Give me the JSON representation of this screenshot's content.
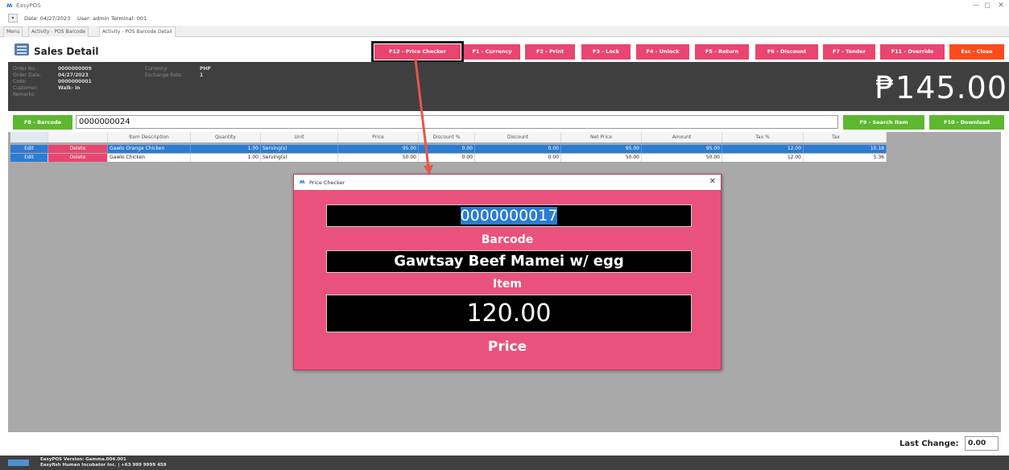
{
  "window": {
    "app_title": "EasyPOS",
    "minimize": "—",
    "maximize": "◻",
    "close": "✕"
  },
  "infobar": {
    "date": "Date: 04/27/2023",
    "user": "User: admin",
    "terminal": "Terminal: 001"
  },
  "tabs": [
    "Menu",
    "Activity - POS Barcode",
    "Activity - POS Barcode Detail"
  ],
  "header": {
    "title": "Sales Detail"
  },
  "function_buttons": [
    {
      "label": "F12 - Price Checker"
    },
    {
      "label": "F1 - Currency"
    },
    {
      "label": "F2 - Print"
    },
    {
      "label": "F3 - Lock"
    },
    {
      "label": "F4 - Unlock"
    },
    {
      "label": "F5 - Return"
    },
    {
      "label": "F6 - Discount"
    },
    {
      "label": "F7 - Tender"
    },
    {
      "label": "F11 - Override"
    },
    {
      "label": "Esc - Close"
    }
  ],
  "order": {
    "labels": {
      "order_no": "Order No.:",
      "order_date": "Order Date:",
      "code": "Code:",
      "customer": "Customer:",
      "remarks": "Remarks:",
      "currency": "Currency:",
      "exchange_rate": "Exchange Rate:"
    },
    "order_no": "0000000009",
    "order_date": "04/27/2023",
    "code": "0000000001",
    "customer": "Walk- In",
    "currency": "PHP",
    "exchange_rate": "1",
    "total": "₱145.00"
  },
  "barcode_row": {
    "barcode_button": "F8 - Barcode",
    "barcode_value": "0000000024",
    "search_button": "F9 - Search Item",
    "download_button": "F10 - Download"
  },
  "grid": {
    "columns": [
      "Item Description",
      "Quantity",
      "Unit",
      "Price",
      "Discount %",
      "Discount",
      "Net Price",
      "Amount",
      "Tax %",
      "Tax"
    ],
    "rows": [
      {
        "edit": "Edit",
        "delete": "Delete",
        "item": "Gawlo Orange Chicken",
        "quantity": "1.00",
        "unit": "Serving(s)",
        "price": "95.00",
        "discount_pct": "0.00",
        "discount": "0.00",
        "net_price": "95.00",
        "amount": "95.00",
        "tax_pct": "12.00",
        "tax": "10.18"
      },
      {
        "edit": "Edit",
        "delete": "Delete",
        "item": "Gawlo Chicken",
        "quantity": "1.00",
        "unit": "Serving(s)",
        "price": "50.00",
        "discount_pct": "0.00",
        "discount": "0.00",
        "net_price": "50.00",
        "amount": "50.00",
        "tax_pct": "12.00",
        "tax": "5.36"
      }
    ]
  },
  "footer": {
    "last_change_label": "Last Change:",
    "last_change_value": "0.00",
    "version": "EasyPOS Version: Gamma.004.001",
    "company": "Easyfish Human Incubator Inc. | +63 999 9999 459"
  },
  "price_checker": {
    "title": "Price Checker",
    "barcode": "0000000017",
    "barcode_label": "Barcode",
    "item": "Gawtsay Beef Mamei w/ egg",
    "item_label": "Item",
    "price": "120.00",
    "price_label": "Price",
    "close": "✕"
  },
  "colors": {
    "pink": "#e9456f",
    "dialog_pink": "#e9527c",
    "green": "#5cb82f",
    "blue": "#2b7cd3",
    "esc_orange": "#ff4a1c",
    "dark_panel": "#3f3f3f"
  }
}
